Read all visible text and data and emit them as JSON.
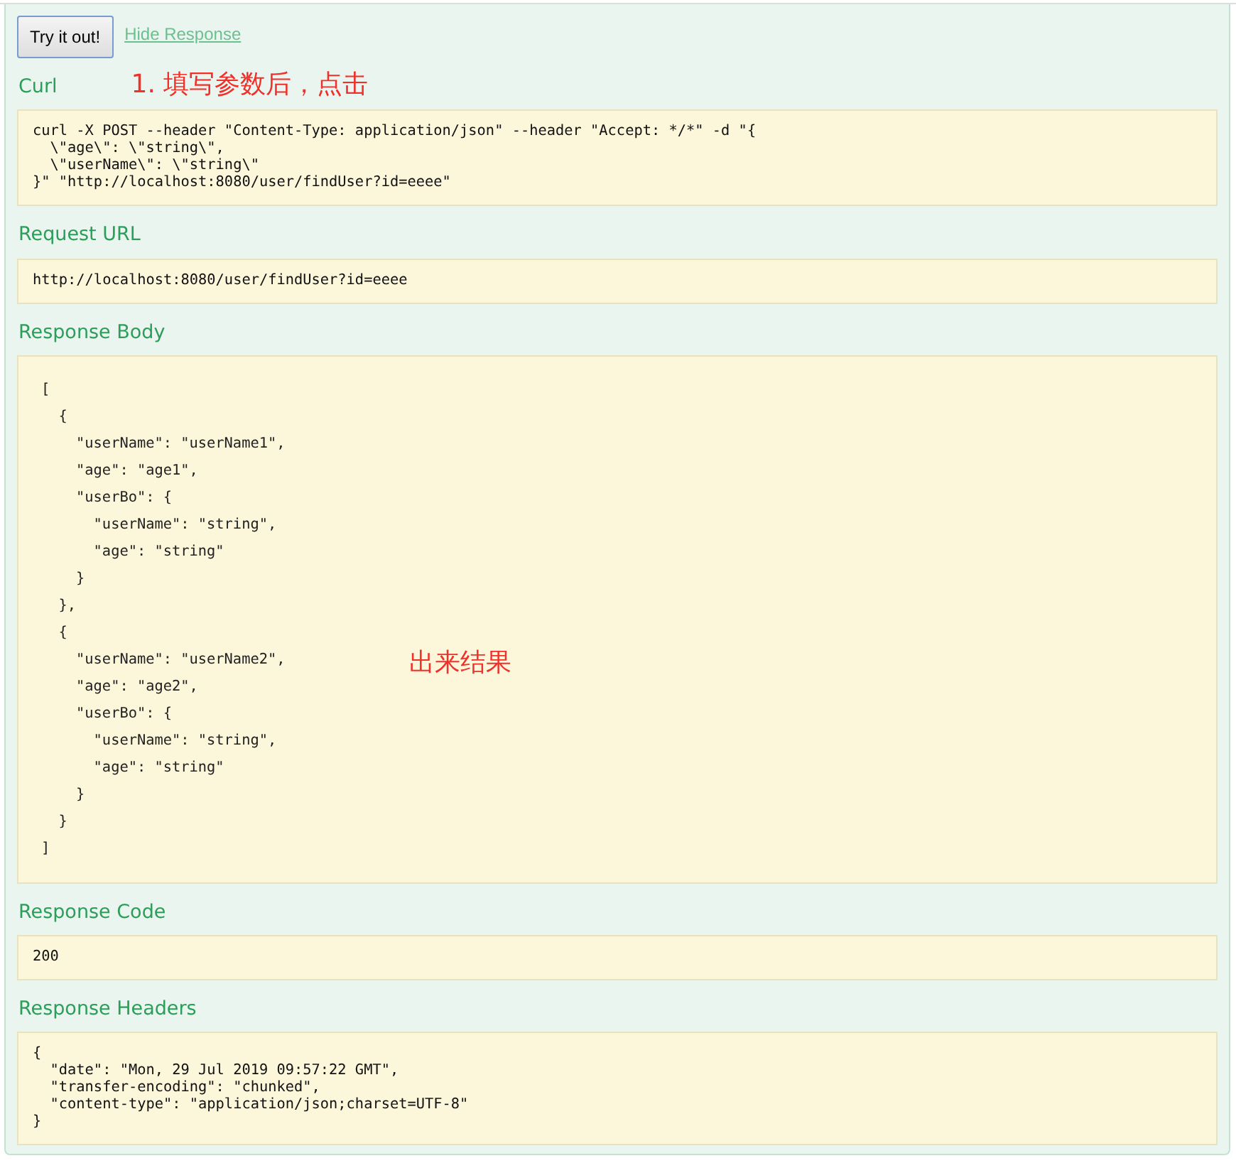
{
  "try_button": {
    "label": "Try it out!"
  },
  "hide_link": {
    "label": "Hide Response"
  },
  "sections": [
    {
      "title": "Curl",
      "kind": "block",
      "text": "curl -X POST --header \"Content-Type: application/json\" --header \"Accept: */*\" -d \"{\n  \\\"age\\\": \\\"string\\\",\n  \\\"userName\\\": \\\"string\\\"\n}\" \"http://localhost:8080/user/findUser?id=eeee\"",
      "annotation": "1. 填写参数后，点击"
    },
    {
      "title": "Request URL",
      "kind": "block",
      "text": "http://localhost:8080/user/findUser?id=eeee"
    },
    {
      "title": "Response Body",
      "kind": "json",
      "text": "[\n  {\n    \"userName\": \"userName1\",\n    \"age\": \"age1\",\n    \"userBo\": {\n      \"userName\": \"string\",\n      \"age\": \"string\"\n    }\n  },\n  {\n    \"userName\": \"userName2\",\n    \"age\": \"age2\",\n    \"userBo\": {\n      \"userName\": \"string\",\n      \"age\": \"string\"\n    }\n  }\n]",
      "annotation": "出来结果"
    },
    {
      "title": "Response Code",
      "kind": "block",
      "text": "200"
    },
    {
      "title": "Response Headers",
      "kind": "block",
      "text": "{\n  \"date\": \"Mon, 29 Jul 2019 09:57:22 GMT\",\n  \"transfer-encoding\": \"chunked\",\n  \"content-type\": \"application/json;charset=UTF-8\"\n}"
    }
  ]
}
